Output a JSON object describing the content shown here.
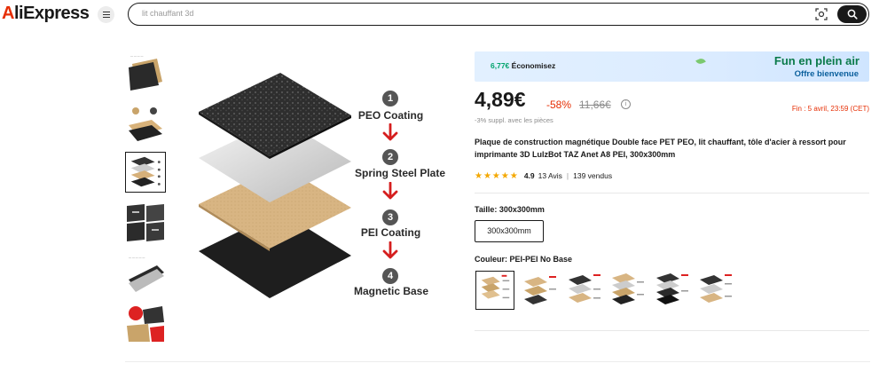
{
  "header": {
    "logo_prefix": "A",
    "logo_rest": "liExpress",
    "menu_icon": "menu-icon",
    "search_value": "lit chauffant 3d",
    "camera_icon": "camera-search-icon",
    "search_icon": "search-icon"
  },
  "gallery": {
    "thumbnail_count": 6,
    "active_index": 2,
    "main_labels": {
      "n1": "1",
      "l1": "PEO Coating",
      "n2": "2",
      "l2": "Spring Steel Plate",
      "n3": "3",
      "l3": "PEI Coating",
      "n4": "4",
      "l4": "Magnetic Base"
    }
  },
  "promo": {
    "amount": "6,77€",
    "amount_label": "Économisez",
    "title": "Fun en plein air",
    "subtitle": "Offre bienvenue"
  },
  "pricing": {
    "price": "4,89€",
    "discount": "-58%",
    "old_price": "11,66€",
    "ends": "Fin : 5 avril, 23:59 (CET)",
    "extra_note": "-3% suppl. avec les pièces"
  },
  "product": {
    "title": "Plaque de construction magnétique Double face PET PEO, lit chauffant, tôle d'acier à ressort pour imprimante 3D LulzBot TAZ Anet A8 PEI, 300x300mm",
    "rating": "4.9",
    "reviews": "13 Avis",
    "sold": "139 vendus",
    "stars": "★★★★★"
  },
  "options": {
    "size_label": "Taille: 300x300mm",
    "size_value": "300x300mm",
    "color_label": "Couleur: PEI-PEI No Base",
    "swatch_count": 6,
    "active_swatch": 0
  },
  "colors": {
    "accent": "#e62e04",
    "promo_green": "#0a7a4a",
    "star": "#f4a800"
  }
}
